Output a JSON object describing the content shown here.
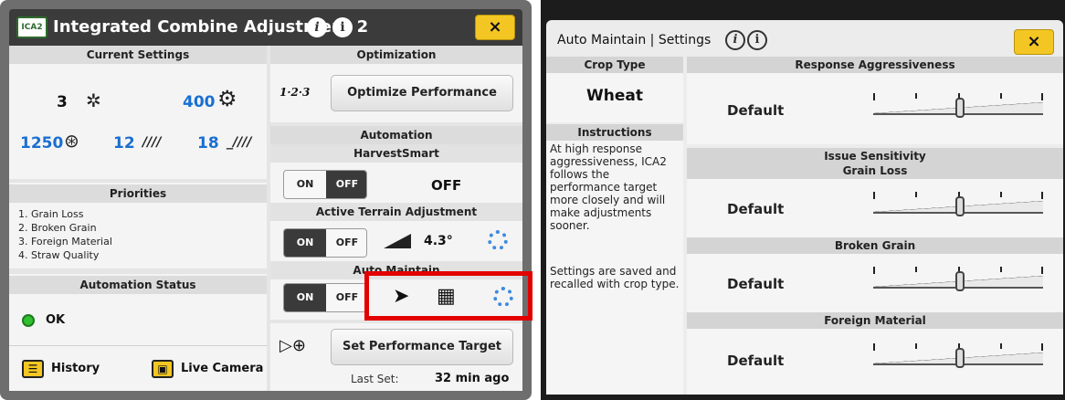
{
  "left": {
    "title": "Integrated Combine Adjustment 2",
    "logo_text": "ICA2",
    "info_glyph": "i",
    "close_label": "×",
    "current_settings": {
      "header": "Current Settings",
      "rotor_speed": "3",
      "fan_speed": "400",
      "rotor_rpm": "1250",
      "chaffer": "12",
      "sieve": "18"
    },
    "priorities": {
      "header": "Priorities",
      "items": [
        "1. Grain Loss",
        "2. Broken Grain",
        "3. Foreign Material",
        "4. Straw Quality"
      ]
    },
    "automation_status": {
      "header": "Automation Status",
      "status": "OK",
      "history_label": "History",
      "live_camera_label": "Live Camera"
    },
    "optimization": {
      "header": "Optimization",
      "icon_text": "1·2·3",
      "button_label": "Optimize Performance"
    },
    "automation": {
      "header": "Automation",
      "harvest_smart": {
        "header": "HarvestSmart",
        "on": "ON",
        "off": "OFF",
        "state": "OFF"
      },
      "active_terrain": {
        "header": "Active Terrain Adjustment",
        "on": "ON",
        "off": "OFF",
        "angle": "4.3°"
      },
      "auto_maintain": {
        "header": "Auto Maintain",
        "on": "ON",
        "off": "OFF"
      }
    },
    "performance_target": {
      "button_label": "Set Performance Target",
      "last_set_label": "Last Set:",
      "last_set_value": "32 min ago"
    }
  },
  "right": {
    "title": "Auto Maintain | Settings",
    "info_glyph": "i",
    "close_label": "×",
    "crop_type": {
      "header": "Crop Type",
      "value": "Wheat"
    },
    "instructions": {
      "header": "Instructions",
      "text1": "At high response aggressiveness, ICA2 follows the performance target more closely and will make adjustments sooner.",
      "text2": "Settings are saved and recalled with crop type."
    },
    "response_aggressiveness": {
      "header": "Response Aggressiveness",
      "value": "Default"
    },
    "issue_sensitivity": {
      "header": "Issue Sensitivity"
    },
    "grain_loss": {
      "header": "Grain Loss",
      "value": "Default"
    },
    "broken_grain": {
      "header": "Broken Grain",
      "value": "Default"
    },
    "foreign_material": {
      "header": "Foreign Material",
      "value": "Default"
    }
  },
  "colors": {
    "accent_blue": "#1a6fd1",
    "close_yellow": "#f3c623",
    "highlight_red": "#e30000",
    "status_green": "#2fbf2f"
  }
}
